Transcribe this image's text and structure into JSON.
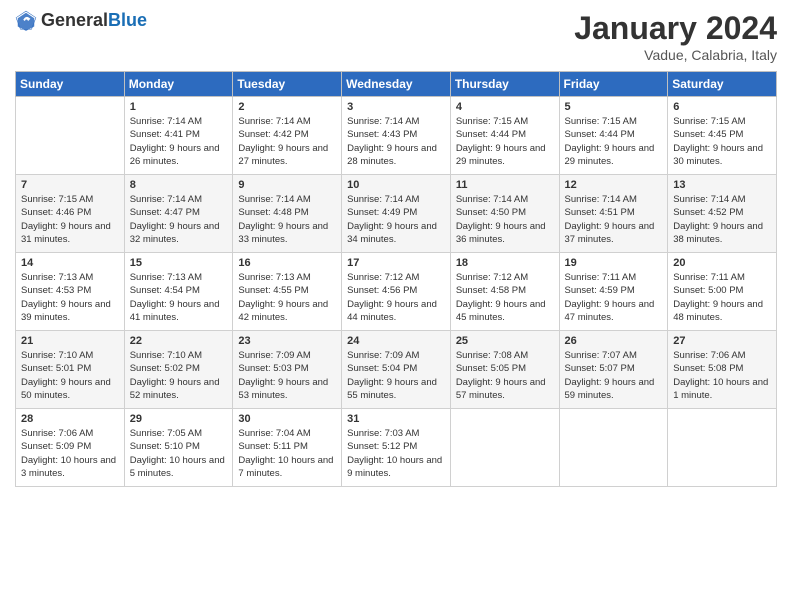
{
  "header": {
    "logo_general": "General",
    "logo_blue": "Blue",
    "month": "January 2024",
    "location": "Vadue, Calabria, Italy"
  },
  "days_of_week": [
    "Sunday",
    "Monday",
    "Tuesday",
    "Wednesday",
    "Thursday",
    "Friday",
    "Saturday"
  ],
  "weeks": [
    [
      {
        "day": "",
        "sunrise": "",
        "sunset": "",
        "daylight": ""
      },
      {
        "day": "1",
        "sunrise": "Sunrise: 7:14 AM",
        "sunset": "Sunset: 4:41 PM",
        "daylight": "Daylight: 9 hours and 26 minutes."
      },
      {
        "day": "2",
        "sunrise": "Sunrise: 7:14 AM",
        "sunset": "Sunset: 4:42 PM",
        "daylight": "Daylight: 9 hours and 27 minutes."
      },
      {
        "day": "3",
        "sunrise": "Sunrise: 7:14 AM",
        "sunset": "Sunset: 4:43 PM",
        "daylight": "Daylight: 9 hours and 28 minutes."
      },
      {
        "day": "4",
        "sunrise": "Sunrise: 7:15 AM",
        "sunset": "Sunset: 4:44 PM",
        "daylight": "Daylight: 9 hours and 29 minutes."
      },
      {
        "day": "5",
        "sunrise": "Sunrise: 7:15 AM",
        "sunset": "Sunset: 4:44 PM",
        "daylight": "Daylight: 9 hours and 29 minutes."
      },
      {
        "day": "6",
        "sunrise": "Sunrise: 7:15 AM",
        "sunset": "Sunset: 4:45 PM",
        "daylight": "Daylight: 9 hours and 30 minutes."
      }
    ],
    [
      {
        "day": "7",
        "sunrise": "Sunrise: 7:15 AM",
        "sunset": "Sunset: 4:46 PM",
        "daylight": "Daylight: 9 hours and 31 minutes."
      },
      {
        "day": "8",
        "sunrise": "Sunrise: 7:14 AM",
        "sunset": "Sunset: 4:47 PM",
        "daylight": "Daylight: 9 hours and 32 minutes."
      },
      {
        "day": "9",
        "sunrise": "Sunrise: 7:14 AM",
        "sunset": "Sunset: 4:48 PM",
        "daylight": "Daylight: 9 hours and 33 minutes."
      },
      {
        "day": "10",
        "sunrise": "Sunrise: 7:14 AM",
        "sunset": "Sunset: 4:49 PM",
        "daylight": "Daylight: 9 hours and 34 minutes."
      },
      {
        "day": "11",
        "sunrise": "Sunrise: 7:14 AM",
        "sunset": "Sunset: 4:50 PM",
        "daylight": "Daylight: 9 hours and 36 minutes."
      },
      {
        "day": "12",
        "sunrise": "Sunrise: 7:14 AM",
        "sunset": "Sunset: 4:51 PM",
        "daylight": "Daylight: 9 hours and 37 minutes."
      },
      {
        "day": "13",
        "sunrise": "Sunrise: 7:14 AM",
        "sunset": "Sunset: 4:52 PM",
        "daylight": "Daylight: 9 hours and 38 minutes."
      }
    ],
    [
      {
        "day": "14",
        "sunrise": "Sunrise: 7:13 AM",
        "sunset": "Sunset: 4:53 PM",
        "daylight": "Daylight: 9 hours and 39 minutes."
      },
      {
        "day": "15",
        "sunrise": "Sunrise: 7:13 AM",
        "sunset": "Sunset: 4:54 PM",
        "daylight": "Daylight: 9 hours and 41 minutes."
      },
      {
        "day": "16",
        "sunrise": "Sunrise: 7:13 AM",
        "sunset": "Sunset: 4:55 PM",
        "daylight": "Daylight: 9 hours and 42 minutes."
      },
      {
        "day": "17",
        "sunrise": "Sunrise: 7:12 AM",
        "sunset": "Sunset: 4:56 PM",
        "daylight": "Daylight: 9 hours and 44 minutes."
      },
      {
        "day": "18",
        "sunrise": "Sunrise: 7:12 AM",
        "sunset": "Sunset: 4:58 PM",
        "daylight": "Daylight: 9 hours and 45 minutes."
      },
      {
        "day": "19",
        "sunrise": "Sunrise: 7:11 AM",
        "sunset": "Sunset: 4:59 PM",
        "daylight": "Daylight: 9 hours and 47 minutes."
      },
      {
        "day": "20",
        "sunrise": "Sunrise: 7:11 AM",
        "sunset": "Sunset: 5:00 PM",
        "daylight": "Daylight: 9 hours and 48 minutes."
      }
    ],
    [
      {
        "day": "21",
        "sunrise": "Sunrise: 7:10 AM",
        "sunset": "Sunset: 5:01 PM",
        "daylight": "Daylight: 9 hours and 50 minutes."
      },
      {
        "day": "22",
        "sunrise": "Sunrise: 7:10 AM",
        "sunset": "Sunset: 5:02 PM",
        "daylight": "Daylight: 9 hours and 52 minutes."
      },
      {
        "day": "23",
        "sunrise": "Sunrise: 7:09 AM",
        "sunset": "Sunset: 5:03 PM",
        "daylight": "Daylight: 9 hours and 53 minutes."
      },
      {
        "day": "24",
        "sunrise": "Sunrise: 7:09 AM",
        "sunset": "Sunset: 5:04 PM",
        "daylight": "Daylight: 9 hours and 55 minutes."
      },
      {
        "day": "25",
        "sunrise": "Sunrise: 7:08 AM",
        "sunset": "Sunset: 5:05 PM",
        "daylight": "Daylight: 9 hours and 57 minutes."
      },
      {
        "day": "26",
        "sunrise": "Sunrise: 7:07 AM",
        "sunset": "Sunset: 5:07 PM",
        "daylight": "Daylight: 9 hours and 59 minutes."
      },
      {
        "day": "27",
        "sunrise": "Sunrise: 7:06 AM",
        "sunset": "Sunset: 5:08 PM",
        "daylight": "Daylight: 10 hours and 1 minute."
      }
    ],
    [
      {
        "day": "28",
        "sunrise": "Sunrise: 7:06 AM",
        "sunset": "Sunset: 5:09 PM",
        "daylight": "Daylight: 10 hours and 3 minutes."
      },
      {
        "day": "29",
        "sunrise": "Sunrise: 7:05 AM",
        "sunset": "Sunset: 5:10 PM",
        "daylight": "Daylight: 10 hours and 5 minutes."
      },
      {
        "day": "30",
        "sunrise": "Sunrise: 7:04 AM",
        "sunset": "Sunset: 5:11 PM",
        "daylight": "Daylight: 10 hours and 7 minutes."
      },
      {
        "day": "31",
        "sunrise": "Sunrise: 7:03 AM",
        "sunset": "Sunset: 5:12 PM",
        "daylight": "Daylight: 10 hours and 9 minutes."
      },
      {
        "day": "",
        "sunrise": "",
        "sunset": "",
        "daylight": ""
      },
      {
        "day": "",
        "sunrise": "",
        "sunset": "",
        "daylight": ""
      },
      {
        "day": "",
        "sunrise": "",
        "sunset": "",
        "daylight": ""
      }
    ]
  ]
}
